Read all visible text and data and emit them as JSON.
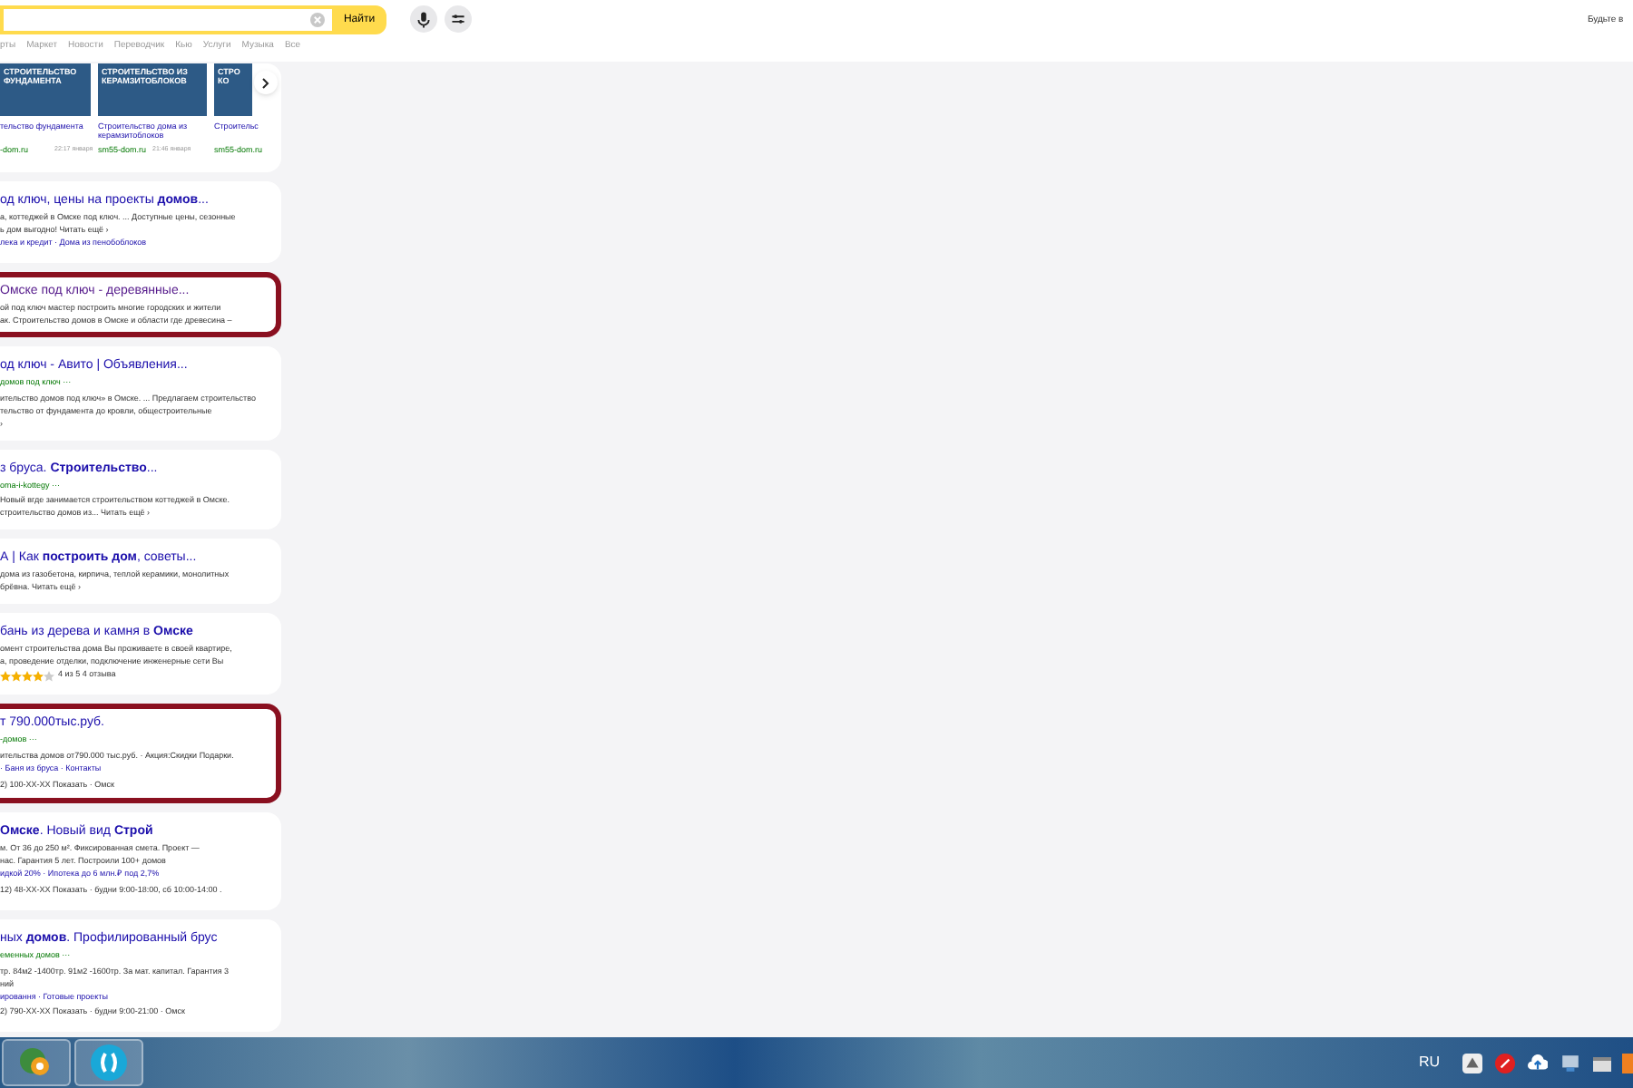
{
  "search": {
    "button": "Найти"
  },
  "top_right": "Будьте в",
  "nav_tabs": [
    {
      "label": "рты"
    },
    {
      "label": "Маркет"
    },
    {
      "label": "Новости"
    },
    {
      "label": "Переводчик"
    },
    {
      "label": "Кью"
    },
    {
      "label": "Услуги"
    },
    {
      "label": "Музыка"
    },
    {
      "label": "Все"
    }
  ],
  "image_results": [
    {
      "caption": "СТРОИТЕЛЬСТВО ФУНДАМЕНТА",
      "title": "тельство фундамента",
      "site": "-dom.ru",
      "time": "22:17 января"
    },
    {
      "caption": "СТРОИТЕЛЬСТВО ИЗ КЕРАМЗИТОБЛОКОВ",
      "title": "Строительство дома из керамзитоблоков",
      "site": "sm55-dom.ru",
      "time": "21:46 января"
    },
    {
      "caption": "СТРО КО",
      "title": "Строительс",
      "site": "sm55-dom.ru"
    }
  ],
  "results": [
    {
      "title": "од ключ, цены на проекты **домов**...",
      "visited": false,
      "highlighted": false,
      "lines": [
        "а, коттеджей в Омске под ключ. ... Доступные цены, сезонные",
        "ь дом выгодно! Читать ещё ›"
      ],
      "links": "лека и кредит · Дома из пенобоблоков"
    },
    {
      "title": "Омске под ключ - деревянные...",
      "visited": true,
      "highlighted": true,
      "lines": [
        "ой под ключ мастер построить многие городских и жители",
        "ак. Строительство домов в Омске и области где древесина –"
      ]
    },
    {
      "title": "од ключ - Авито | Объявления...",
      "visited": false,
      "highlighted": false,
      "url": "домов под ключ ···",
      "lines": [
        "ительство домов под ключ» в Омске. ... Предлагаем строительство",
        "тельство от фундамента до кровли, общестроительные",
        "›"
      ]
    },
    {
      "title": "з бруса. **Строительство**...",
      "visited": false,
      "highlighted": false,
      "url": "oma-i-kottegy ···",
      "lines": [
        "Новый вгде занимается строительством коттеджей в Омске.",
        "строительство домов из... Читать ещё ›"
      ]
    },
    {
      "title": "А | Как **построить дом**, советы...",
      "visited": false,
      "highlighted": false,
      "lines": [
        "дома из газобетона, кирпича, теплой керамики, монолитных",
        "брёвна. Читать ещё ›"
      ]
    },
    {
      "title": "бань из дерева и камня в **Омске**",
      "visited": false,
      "highlighted": false,
      "lines": [
        "омент строительства дома Вы проживаете в своей квартире,",
        "а, проведение отделки, подключение инженерные сети Вы"
      ],
      "stars": 4,
      "rating": "4 из 5  4 отзыва"
    },
    {
      "title": "т 790.000тыс.руб.",
      "visited": false,
      "highlighted": true,
      "url": "-домов ···",
      "lines": [
        "ительства домов от790.000 тыс.руб. · Акция:Скидки Подарки."
      ],
      "links": "· Баня из бруса · Контакты",
      "contact": "2) 100-XX-XX Показать · Омск"
    },
    {
      "title": "**Омске**. Новый вид **Строй**",
      "visited": false,
      "highlighted": false,
      "lines": [
        "м. От 36 до 250 м². Фиксированная смета. Проект —",
        "нас. Гарантия 5 лет. Построили 100+ домов"
      ],
      "links": "идкой 20% · Ипотека до 6 млн.₽ под 2,7%",
      "contact": "12) 48-XX-XX Показать · будни 9:00-18:00, сб 10:00-14:00 ."
    },
    {
      "title": "ных **домов**. Профилированный брус",
      "visited": false,
      "highlighted": false,
      "url": "еменных домов ···",
      "lines": [
        "тр. 84м2 -1400тр. 91м2 -1600тр. За мат. капитал. Гарантия 3",
        "ний"
      ],
      "links": "ировання · Готовые проекты",
      "contact": "2) 790-XX-XX Показать · будни 9:00-21:00 · Омск"
    }
  ],
  "taskbar": {
    "language": "RU"
  }
}
